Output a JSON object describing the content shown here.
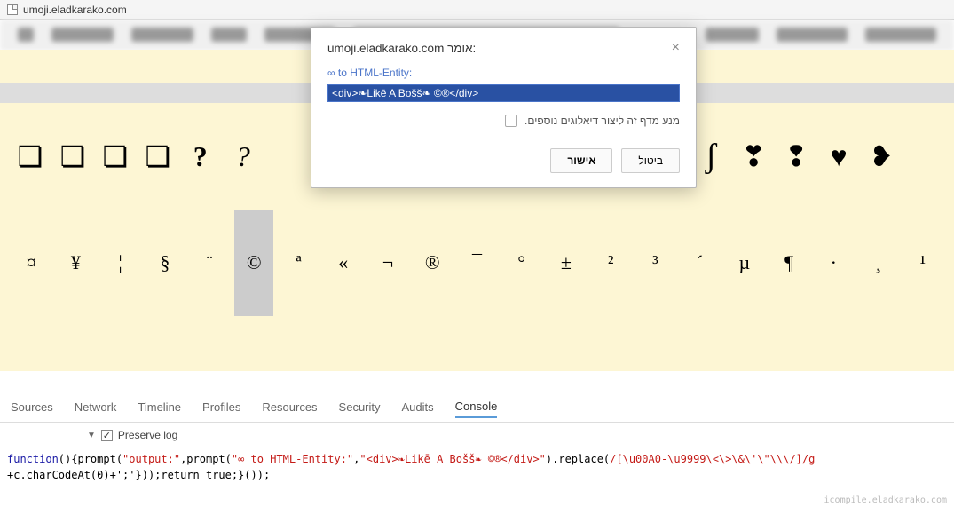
{
  "title": "umoji.eladkarako.com",
  "blurred_items_widths": [
    18,
    70,
    70,
    40,
    80,
    300,
    60,
    80,
    80
  ],
  "modal": {
    "says_text": "umoji.eladkarako.com אומר:",
    "label": "∞ to HTML-Entity:",
    "input_value": "<div>❧Likē A Bošš❧ ©®</div>",
    "checkbox_label": "מנע מדף זה ליצור דיאלוגים נוספים.",
    "ok_label": "אישור",
    "cancel_label": "ביטול"
  },
  "char_row_1": [
    "❏",
    "❏",
    "❏",
    "❏",
    "?",
    "?",
    "",
    "",
    "",
    "",
    "",
    "",
    "",
    "",
    "",
    "",
    "ʃ",
    "❣",
    "❢",
    "♥",
    "❥",
    ""
  ],
  "char_row_2": [
    "¤",
    "¥",
    "¦",
    "§",
    "¨",
    "©",
    "ª",
    "«",
    "¬",
    "®",
    "¯",
    "°",
    "±",
    "²",
    "³",
    "´",
    "µ",
    "¶",
    "·",
    "¸",
    "¹"
  ],
  "devtools": {
    "tabs": [
      "Sources",
      "Network",
      "Timeline",
      "Profiles",
      "Resources",
      "Security",
      "Audits",
      "Console"
    ],
    "active_tab": "Console",
    "preserve_log": "Preserve log",
    "code_parts": {
      "p1": "function",
      "p2": "(){prompt(",
      "s1": "\"output:\"",
      "p3": ",prompt(",
      "s2": "\"∞ to HTML-Entity:\"",
      "p4": ",",
      "s3": "\"<div>❧Likē A Bošš❧ ©®</div>\"",
      "p5": ").replace(",
      "re": "/[\\u00A0-\\u9999\\<\\>\\&\\'\\\"\\\\\\/]/g",
      "p6": "+c.charCodeAt(0)+';'}));return true;}());"
    }
  },
  "footer_url": "icompile.eladkarako.com"
}
